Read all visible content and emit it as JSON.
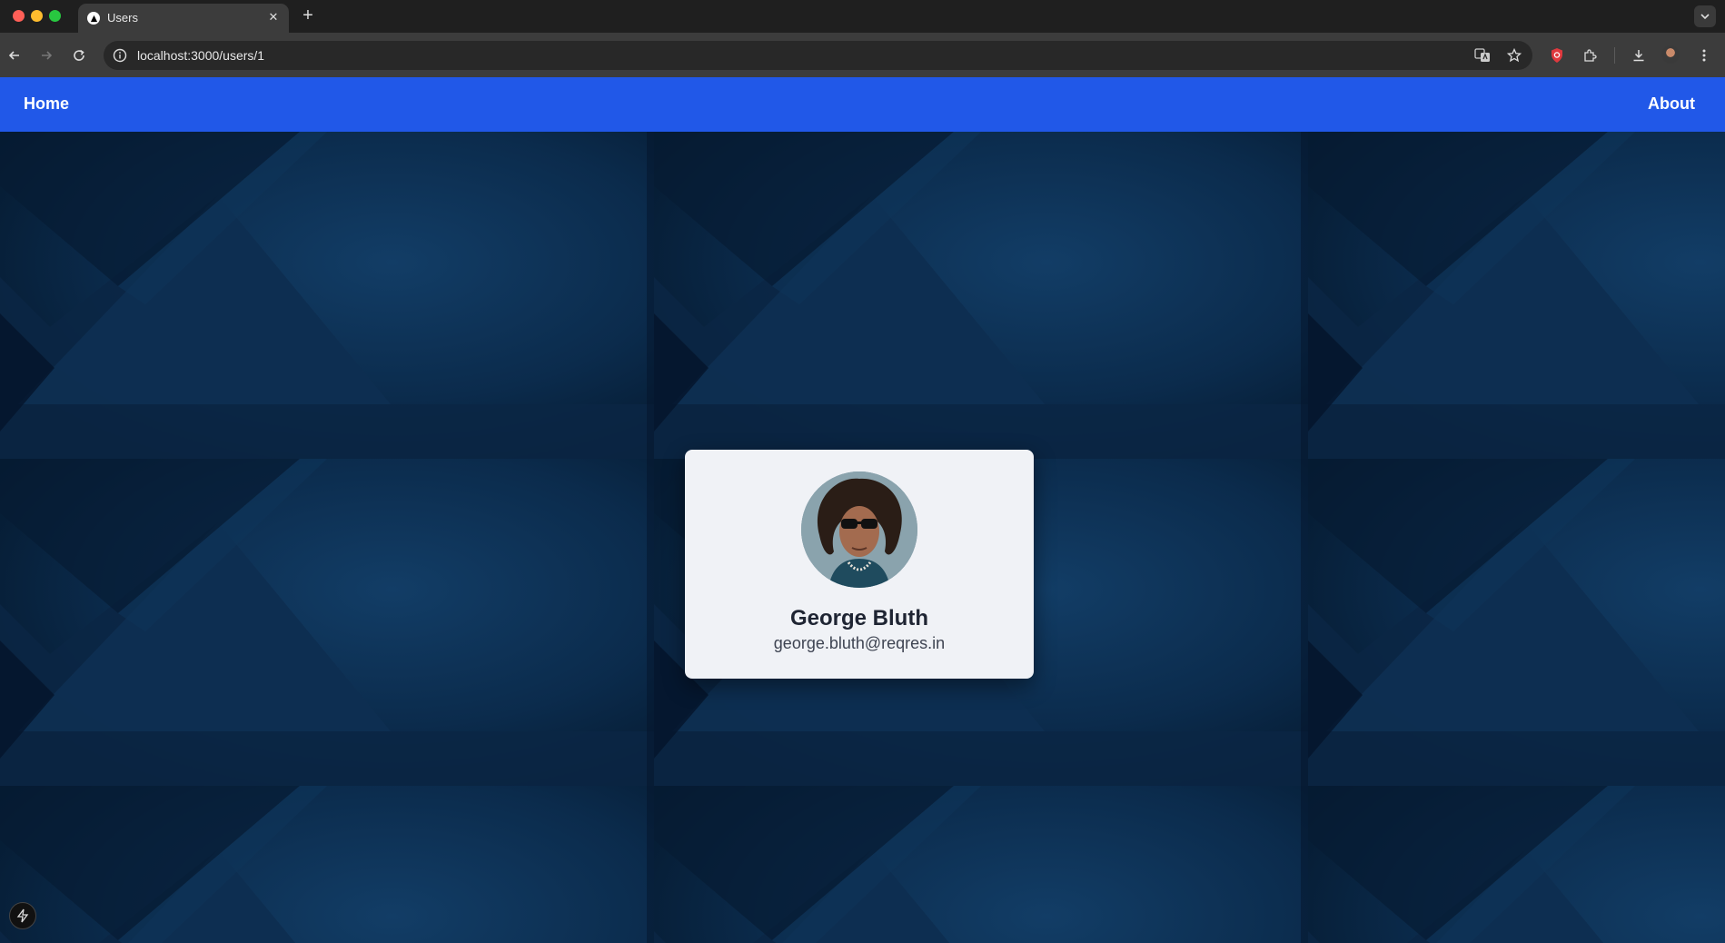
{
  "browser": {
    "tab_title": "Users",
    "url": "localhost:3000/users/1",
    "tab_close_glyph": "✕",
    "new_tab_glyph": "+"
  },
  "nav": {
    "home_label": "Home",
    "about_label": "About"
  },
  "user": {
    "name": "George Bluth",
    "email": "george.bluth@reqres.in"
  },
  "colors": {
    "navbar": "#2158e8",
    "background": "#0b2a4a",
    "card": "#f0f2f6"
  },
  "icons": {
    "back": "arrow-left-icon",
    "forward": "arrow-right-icon",
    "reload": "reload-icon",
    "site_info": "info-icon",
    "translate": "translate-icon",
    "bookmark": "star-icon",
    "shield": "shield-extension-icon",
    "extensions": "puzzle-icon",
    "download": "download-icon",
    "menu": "kebab-menu-icon",
    "dev_indicator": "lightning-icon"
  }
}
